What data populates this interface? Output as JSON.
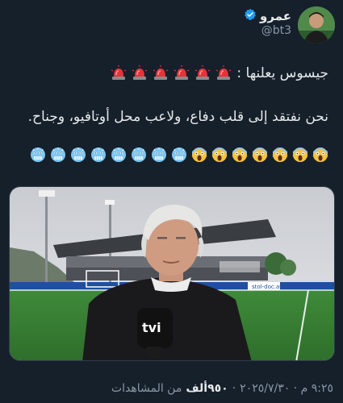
{
  "author": {
    "display_name": "عمرو",
    "handle": "@bt3",
    "verified": true,
    "verified_color": "#1d9bf0"
  },
  "tweet": {
    "line1_text": "جيسوس يعلنها :",
    "siren_icon_count": 6,
    "line2_text": "نحن نفتقد إلى قلب دفاع، ولاعب محل أوتافيو، وجناح.",
    "cold_face_icon_count": 8,
    "screaming_face_icon_count": 7
  },
  "media": {
    "microphone_logo": "tvi",
    "banner_text": "stol-doc.at"
  },
  "meta": {
    "timestamp": "٩:٢٥ م · ٢٠٢٥/٧/٣٠",
    "separator": "·",
    "views_count": "٩٥٠ألف",
    "views_label": "من المشاهدات"
  },
  "colors": {
    "background": "#15202b",
    "text": "#e7e9ea",
    "secondary_text": "#8b98a5",
    "accent": "#1d9bf0"
  }
}
